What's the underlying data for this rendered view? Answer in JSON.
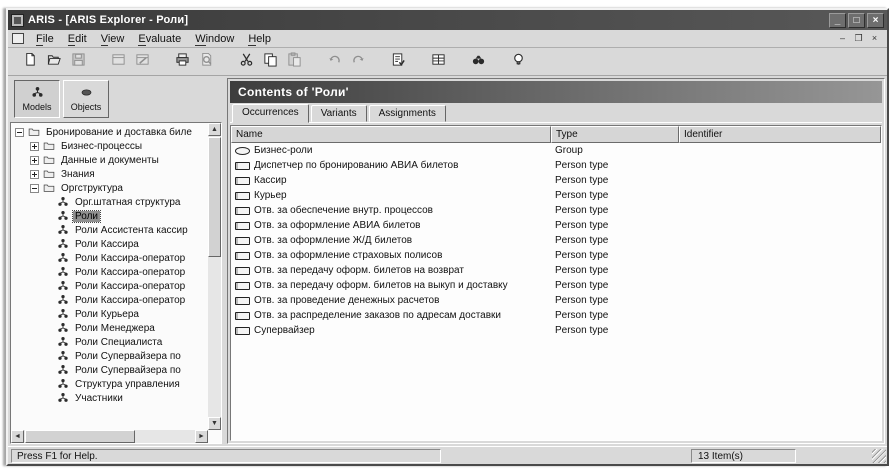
{
  "window": {
    "title": "ARIS - [ARIS Explorer - Роли]",
    "controls": {
      "minimize": "_",
      "maximize": "□",
      "close": "×"
    }
  },
  "menu": {
    "items": [
      "File",
      "Edit",
      "View",
      "Evaluate",
      "Window",
      "Help"
    ],
    "child_controls": {
      "minimize": "–",
      "restore": "❐",
      "close": "×"
    }
  },
  "toolbar": {
    "groups": [
      {
        "buttons": [
          {
            "name": "new",
            "icon": "new-document-icon",
            "disabled": false
          },
          {
            "name": "open",
            "icon": "open-folder-icon",
            "disabled": false
          },
          {
            "name": "save",
            "icon": "save-icon",
            "disabled": true
          }
        ]
      },
      {
        "buttons": [
          {
            "name": "window",
            "icon": "window-icon",
            "disabled": true
          },
          {
            "name": "window-edit",
            "icon": "window-edit-icon",
            "disabled": true
          }
        ]
      },
      {
        "buttons": [
          {
            "name": "print",
            "icon": "printer-icon",
            "disabled": false
          },
          {
            "name": "print-preview",
            "icon": "print-preview-icon",
            "disabled": true
          }
        ]
      },
      {
        "buttons": [
          {
            "name": "cut",
            "icon": "scissors-icon",
            "disabled": false
          },
          {
            "name": "copy",
            "icon": "copy-icon",
            "disabled": false
          },
          {
            "name": "paste",
            "icon": "paste-icon",
            "disabled": true
          }
        ]
      },
      {
        "buttons": [
          {
            "name": "undo",
            "icon": "undo-arrow-icon",
            "disabled": true
          },
          {
            "name": "redo",
            "icon": "redo-arrow-icon",
            "disabled": true
          }
        ]
      },
      {
        "buttons": [
          {
            "name": "properties",
            "icon": "properties-icon",
            "disabled": false
          }
        ]
      },
      {
        "buttons": [
          {
            "name": "attributes",
            "icon": "attributes-icon",
            "disabled": false
          }
        ]
      },
      {
        "buttons": [
          {
            "name": "find",
            "icon": "binoculars-icon",
            "disabled": false
          }
        ]
      },
      {
        "buttons": [
          {
            "name": "tip-of-day",
            "icon": "lightbulb-icon",
            "disabled": false
          }
        ]
      }
    ]
  },
  "mode_buttons": [
    {
      "label": "Models",
      "icon": "org-chart-icon",
      "active": true
    },
    {
      "label": "Objects",
      "icon": "oval-icon",
      "active": false
    }
  ],
  "tree": {
    "items": [
      {
        "label": "Бронирование и доставка биле",
        "level": 0,
        "icon": "folder",
        "expander": "minus",
        "selected": false
      },
      {
        "label": "Бизнес-процессы",
        "level": 1,
        "icon": "folder",
        "expander": "plus",
        "selected": false
      },
      {
        "label": "Данные и документы",
        "level": 1,
        "icon": "folder",
        "expander": "plus",
        "selected": false
      },
      {
        "label": "Знания",
        "level": 1,
        "icon": "folder",
        "expander": "plus",
        "selected": false
      },
      {
        "label": "Оргструктура",
        "level": 1,
        "icon": "folder",
        "expander": "minus",
        "selected": false
      },
      {
        "label": "Орг.штатная структура",
        "level": 2,
        "icon": "org",
        "expander": null,
        "selected": false
      },
      {
        "label": "Роли",
        "level": 2,
        "icon": "org",
        "expander": null,
        "selected": true
      },
      {
        "label": "Роли Ассистента кассир",
        "level": 2,
        "icon": "org",
        "expander": null,
        "selected": false
      },
      {
        "label": "Роли Кассира",
        "level": 2,
        "icon": "org",
        "expander": null,
        "selected": false
      },
      {
        "label": "Роли Кассира-оператор",
        "level": 2,
        "icon": "org",
        "expander": null,
        "selected": false
      },
      {
        "label": "Роли Кассира-оператор",
        "level": 2,
        "icon": "org",
        "expander": null,
        "selected": false
      },
      {
        "label": "Роли Кассира-оператор",
        "level": 2,
        "icon": "org",
        "expander": null,
        "selected": false
      },
      {
        "label": "Роли Кассира-оператор",
        "level": 2,
        "icon": "org",
        "expander": null,
        "selected": false
      },
      {
        "label": "Роли Курьера",
        "level": 2,
        "icon": "org",
        "expander": null,
        "selected": false
      },
      {
        "label": "Роли Менеджера",
        "level": 2,
        "icon": "org",
        "expander": null,
        "selected": false
      },
      {
        "label": "Роли Специалиста",
        "level": 2,
        "icon": "org",
        "expander": null,
        "selected": false
      },
      {
        "label": "Роли Супервайзера по",
        "level": 2,
        "icon": "org",
        "expander": null,
        "selected": false
      },
      {
        "label": "Роли Супервайзера по",
        "level": 2,
        "icon": "org",
        "expander": null,
        "selected": false
      },
      {
        "label": "Структура управления",
        "level": 2,
        "icon": "org",
        "expander": null,
        "selected": false
      },
      {
        "label": "Участники",
        "level": 2,
        "icon": "org",
        "expander": null,
        "selected": false
      }
    ]
  },
  "content": {
    "header": "Contents of 'Роли'",
    "tabs": [
      {
        "label": "Occurrences",
        "active": true
      },
      {
        "label": "Variants",
        "active": false
      },
      {
        "label": "Assignments",
        "active": false
      }
    ],
    "table": {
      "columns": [
        "Name",
        "Type",
        "Identifier"
      ],
      "rows": [
        {
          "icon": "group-icon",
          "name": "Бизнес-роли",
          "type": "Group",
          "identifier": ""
        },
        {
          "icon": "person-type-icon",
          "name": "Диспетчер по бронированию АВИА билетов",
          "type": "Person type",
          "identifier": ""
        },
        {
          "icon": "person-type-icon",
          "name": "Кассир",
          "type": "Person type",
          "identifier": ""
        },
        {
          "icon": "person-type-icon",
          "name": "Курьер",
          "type": "Person type",
          "identifier": ""
        },
        {
          "icon": "person-type-icon",
          "name": "Отв. за обеспечение внутр. процессов",
          "type": "Person type",
          "identifier": ""
        },
        {
          "icon": "person-type-icon",
          "name": "Отв. за оформление АВИА билетов",
          "type": "Person type",
          "identifier": ""
        },
        {
          "icon": "person-type-icon",
          "name": "Отв. за оформление Ж/Д билетов",
          "type": "Person type",
          "identifier": ""
        },
        {
          "icon": "person-type-icon",
          "name": "Отв. за оформление страховых полисов",
          "type": "Person type",
          "identifier": ""
        },
        {
          "icon": "person-type-icon",
          "name": "Отв. за передачу оформ. билетов на возврат",
          "type": "Person type",
          "identifier": ""
        },
        {
          "icon": "person-type-icon",
          "name": "Отв. за передачу оформ. билетов на выкуп и доставку",
          "type": "Person type",
          "identifier": ""
        },
        {
          "icon": "person-type-icon",
          "name": "Отв. за проведение денежных расчетов",
          "type": "Person type",
          "identifier": ""
        },
        {
          "icon": "person-type-icon",
          "name": "Отв. за распределение заказов по адресам доставки",
          "type": "Person type",
          "identifier": ""
        },
        {
          "icon": "person-type-icon",
          "name": "Супервайзер",
          "type": "Person type",
          "identifier": ""
        }
      ]
    }
  },
  "status_bar": {
    "left": "Press F1 for Help.",
    "right": "13 Item(s)"
  }
}
